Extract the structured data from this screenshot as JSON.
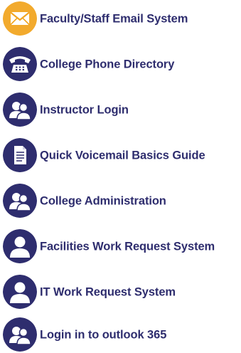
{
  "colors": {
    "navy": "#2e2d6e",
    "orange": "#f2a623",
    "text": "#2e2d6e",
    "white": "#ffffff"
  },
  "links": [
    {
      "label": "Faculty/Staff Email System",
      "icon": "envelope-icon",
      "color": "#f2a623"
    },
    {
      "label": "College Phone Directory",
      "icon": "telephone-icon",
      "color": "#2e2d6e"
    },
    {
      "label": "Instructor Login",
      "icon": "users-icon",
      "color": "#2e2d6e"
    },
    {
      "label": "Quick Voicemail Basics Guide",
      "icon": "document-icon",
      "color": "#2e2d6e"
    },
    {
      "label": "College Administration",
      "icon": "users-icon",
      "color": "#2e2d6e"
    },
    {
      "label": "Facilities Work Request System",
      "icon": "user-icon",
      "color": "#2e2d6e"
    },
    {
      "label": "IT Work Request System",
      "icon": "user-icon",
      "color": "#2e2d6e"
    },
    {
      "label": "Login in to outlook 365",
      "icon": "users-icon",
      "color": "#2e2d6e"
    }
  ]
}
